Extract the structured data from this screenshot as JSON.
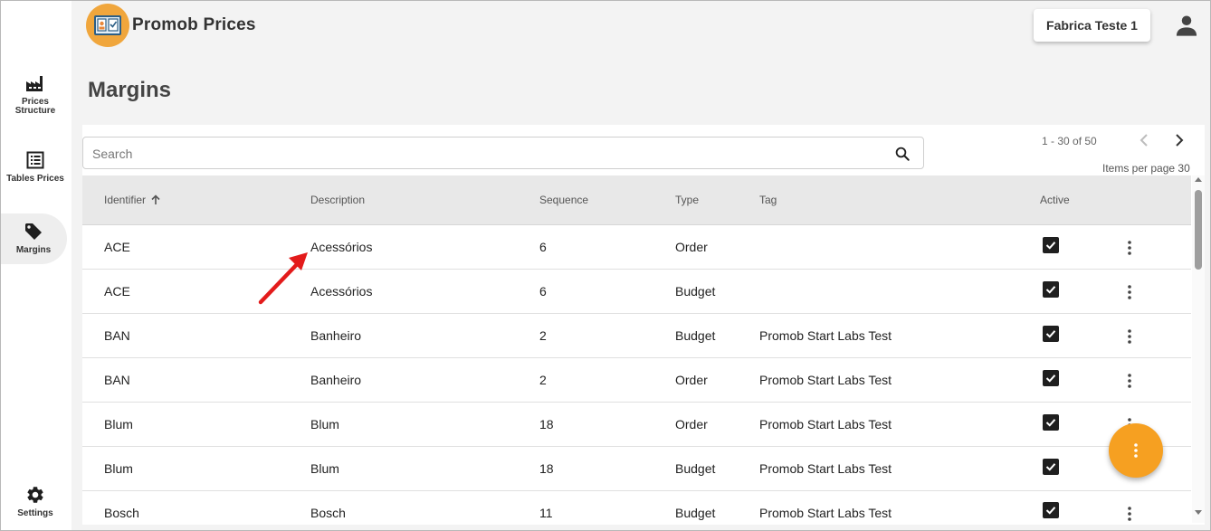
{
  "app": {
    "title": "Promob Prices",
    "factory": "Fabrica Teste 1"
  },
  "sidebar": {
    "items": [
      {
        "label": "Prices Structure",
        "icon": "factory-icon"
      },
      {
        "label": "Tables Prices",
        "icon": "list-icon"
      },
      {
        "label": "Margins",
        "icon": "tag-icon"
      },
      {
        "label": "Settings",
        "icon": "gear-icon"
      }
    ],
    "prices_line1": "Prices",
    "prices_line2": "Structure"
  },
  "page": {
    "title": "Margins"
  },
  "search": {
    "placeholder": "Search"
  },
  "pager": {
    "range": "1 - 30 of 50",
    "items_label": "Items per page",
    "items_value": "30"
  },
  "table": {
    "columns": {
      "identifier": "Identifier",
      "description": "Description",
      "sequence": "Sequence",
      "type": "Type",
      "tag": "Tag",
      "active": "Active"
    },
    "rows": [
      {
        "identifier": "ACE",
        "description": "Acessórios",
        "sequence": "6",
        "type": "Order",
        "tag": "",
        "active": true
      },
      {
        "identifier": "ACE",
        "description": "Acessórios",
        "sequence": "6",
        "type": "Budget",
        "tag": "",
        "active": true
      },
      {
        "identifier": "BAN",
        "description": "Banheiro",
        "sequence": "2",
        "type": "Budget",
        "tag": "Promob Start Labs Test",
        "active": true
      },
      {
        "identifier": "BAN",
        "description": "Banheiro",
        "sequence": "2",
        "type": "Order",
        "tag": "Promob Start Labs Test",
        "active": true
      },
      {
        "identifier": "Blum",
        "description": "Blum",
        "sequence": "18",
        "type": "Order",
        "tag": "Promob Start Labs Test",
        "active": true
      },
      {
        "identifier": "Blum",
        "description": "Blum",
        "sequence": "18",
        "type": "Budget",
        "tag": "Promob Start Labs Test",
        "active": true
      },
      {
        "identifier": "Bosch",
        "description": "Bosch",
        "sequence": "11",
        "type": "Budget",
        "tag": "Promob Start Labs Test",
        "active": true
      }
    ]
  },
  "colors": {
    "accent": "#f6a021",
    "logo_bg": "#f0a63c",
    "annotation": "#e31b1b"
  }
}
